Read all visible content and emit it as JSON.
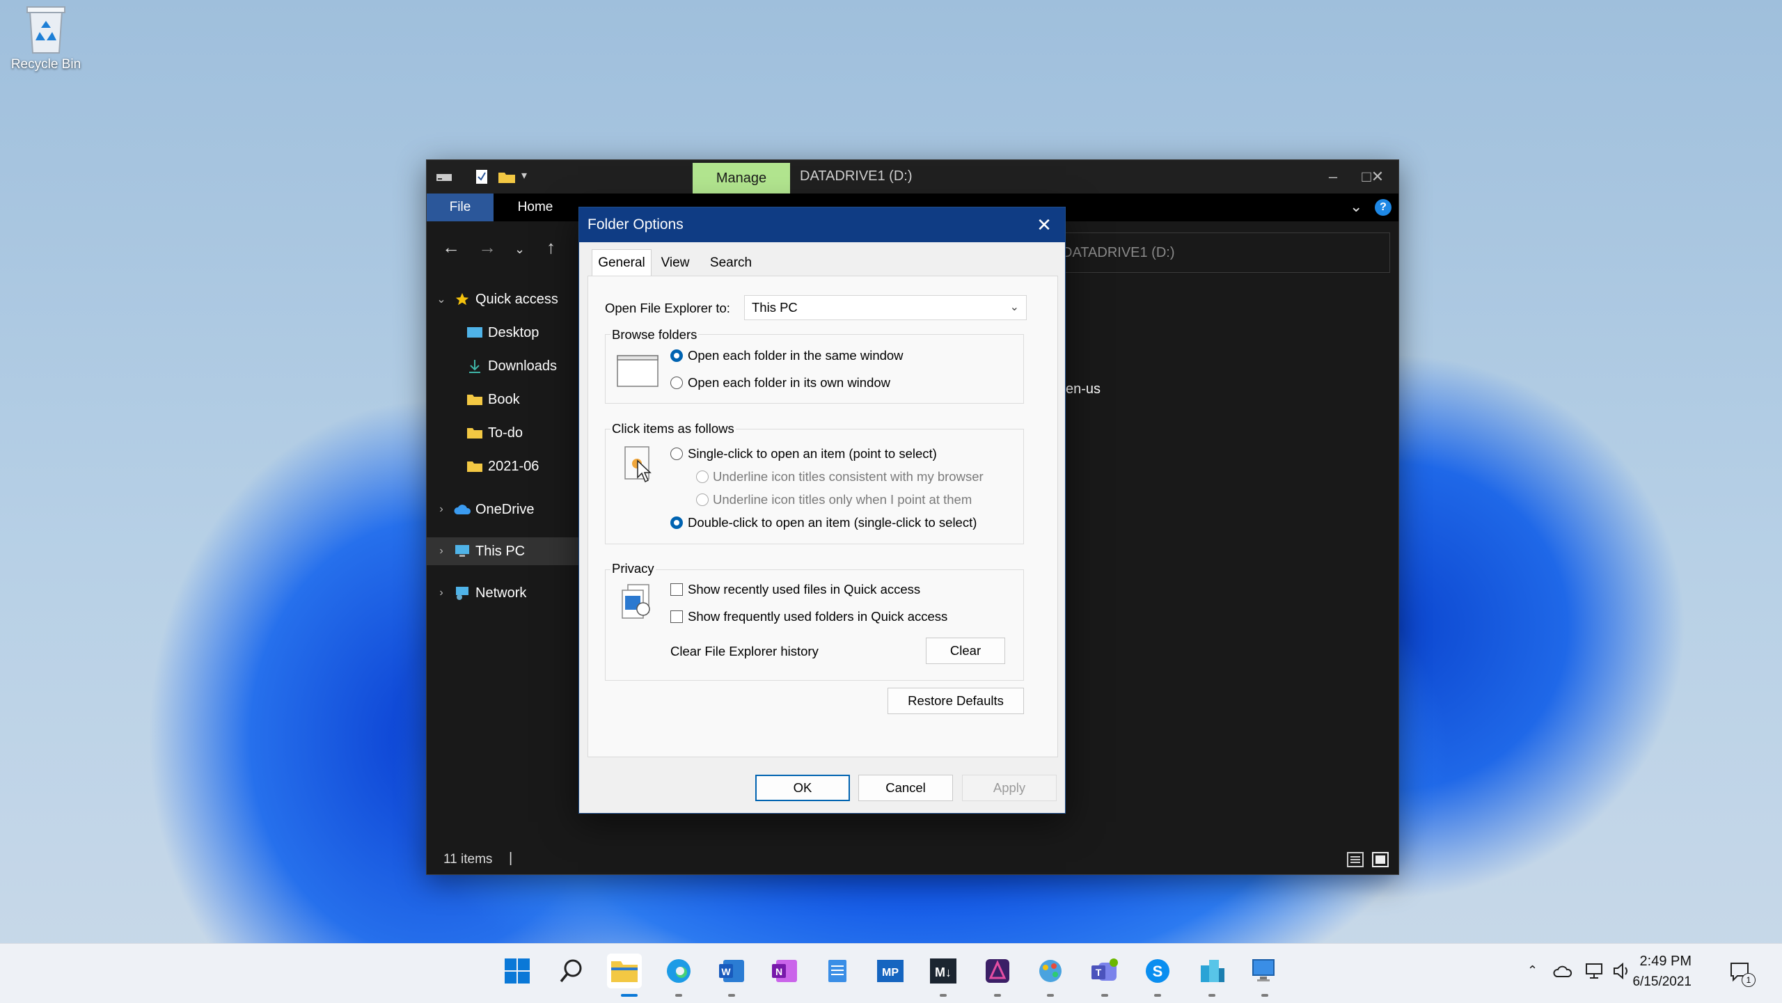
{
  "desktop": {
    "recycle_bin_label": "Recycle Bin"
  },
  "explorer": {
    "contextual_tab": "Manage",
    "window_title": "DATADRIVE1 (D:)",
    "ribbon_file": "File",
    "ribbon_home": "Home",
    "address_text": "DATADRIVE1 (D:)",
    "nav": {
      "quick_access": "Quick access",
      "desktop": "Desktop",
      "downloads": "Downloads",
      "book": "Book",
      "todo": "To-do",
      "folder_2021": "2021-06",
      "onedrive": "OneDrive",
      "this_pc": "This PC",
      "network": "Network"
    },
    "content_fragment": "en-us",
    "status_items": "11 items"
  },
  "dialog": {
    "title": "Folder Options",
    "tabs": {
      "general": "General",
      "view": "View",
      "search": "Search"
    },
    "open_to_label": "Open File Explorer to:",
    "open_to_value": "This PC",
    "browse": {
      "title": "Browse folders",
      "same_window": "Open each folder in the same window",
      "own_window": "Open each folder in its own window",
      "selected": "same_window"
    },
    "click": {
      "title": "Click items as follows",
      "single": "Single-click to open an item (point to select)",
      "underline_browser": "Underline icon titles consistent with my browser",
      "underline_point": "Underline icon titles only when I point at them",
      "double": "Double-click to open an item (single-click to select)",
      "selected": "double"
    },
    "privacy": {
      "title": "Privacy",
      "recent_files": "Show recently used files in Quick access",
      "frequent_folders": "Show frequently used folders in Quick access",
      "clear_history": "Clear File Explorer history",
      "clear_button": "Clear"
    },
    "restore_defaults": "Restore Defaults",
    "ok": "OK",
    "cancel": "Cancel",
    "apply": "Apply"
  },
  "taskbar": {
    "time": "2:49 PM",
    "date": "6/15/2021",
    "notification_count": "1"
  },
  "colors": {
    "dialog_title": "#0f3c84",
    "accent": "#0063b1",
    "manage_tab": "#b2e58f",
    "file_tab": "#2b579a"
  }
}
